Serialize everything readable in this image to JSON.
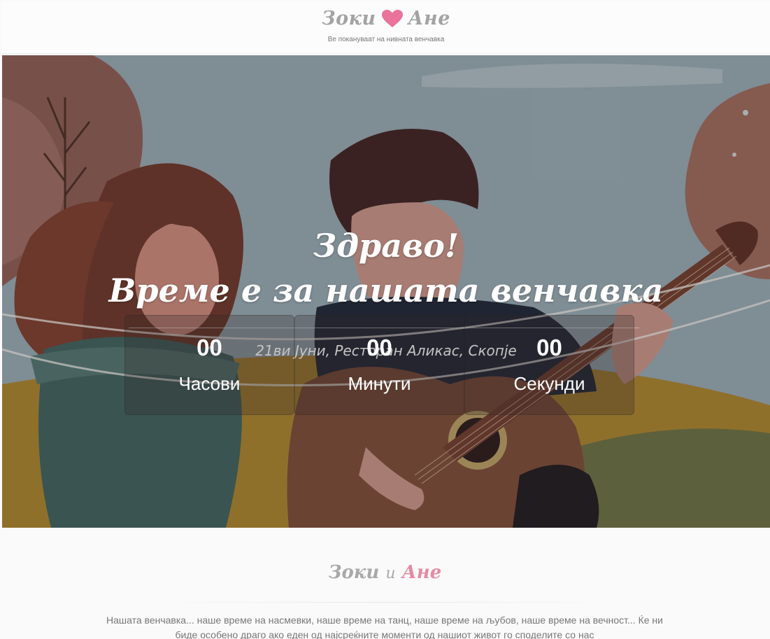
{
  "header": {
    "logo_left": "Зоки",
    "logo_right": "Ане",
    "heart_icon": "heart-icon",
    "heart_color": "#e9739a",
    "tagline": "Ве покануваат на нивната венчавка"
  },
  "hero": {
    "greeting": "Здраво!",
    "headline": "Време е за нашата венчавка",
    "date_place": "21ви Јуни, Ресторан Аликас, Скопје",
    "countdown": [
      {
        "value": "00",
        "label": "Часови"
      },
      {
        "value": "00",
        "label": "Минути"
      },
      {
        "value": "00",
        "label": "Секунди"
      }
    ]
  },
  "about": {
    "name_left": "Зоки",
    "conjunction": "и",
    "name_right": "Ане",
    "accent_color": "#e68aa6",
    "text": "Нашата венчавка... наше време на насмевки, наше време на танц, наше време на љубов, наше време на вечност... Ќе ни биде особено драго ако еден од најсреќните моменти од нашиот живот го споделите со нас"
  }
}
